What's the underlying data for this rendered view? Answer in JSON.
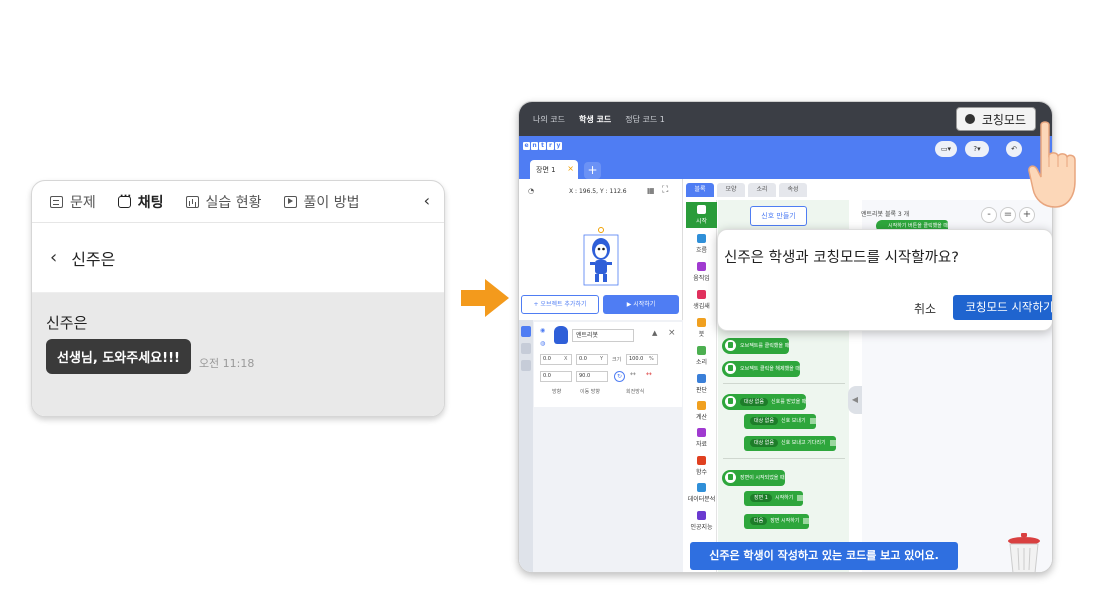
{
  "chat": {
    "tabs": [
      {
        "label": "문제",
        "icon": "document-icon"
      },
      {
        "label": "채팅",
        "icon": "chat-icon"
      },
      {
        "label": "실습 현황",
        "icon": "chart-icon"
      },
      {
        "label": "풀이 방법",
        "icon": "play-icon"
      }
    ],
    "active_tab": "채팅",
    "header_name": "신주은",
    "message": {
      "sender": "신주은",
      "text": "선생님, 도와주세요!!!",
      "time": "오전 11:18"
    }
  },
  "editor": {
    "top_tabs": [
      "나의 코드",
      "학생 코드",
      "정답 코드 1"
    ],
    "active_top_tab": "학생 코드",
    "coaching_mode_label": "코칭모드",
    "logo_letters": [
      "e",
      "n",
      "t",
      "r",
      "y"
    ],
    "scene_tab": "장면 1",
    "coords_text": "X : 196.5, Y : 112.6",
    "add_object_label": "+ 오브젝트 추가하기",
    "start_label": "▶ 시작하기",
    "object": {
      "name": "엔트리봇",
      "x": "0.0",
      "y": "0.0",
      "size": "100.0",
      "direction": "0.0",
      "move_direction": "90.0",
      "labels": {
        "x": "X",
        "y": "Y",
        "size": "크기",
        "size_unit": "%",
        "direction": "방향",
        "move_direction": "이동 방향",
        "rotation": "회전방식"
      }
    },
    "palette_tabs": [
      "블록",
      "모양",
      "소리",
      "속성"
    ],
    "categories": [
      {
        "label": "시작",
        "color": "#2a9c3a",
        "active": true
      },
      {
        "label": "흐름",
        "color": "#2f8fd8"
      },
      {
        "label": "움직임",
        "color": "#a03ad0"
      },
      {
        "label": "생김새",
        "color": "#e0305d"
      },
      {
        "label": "붓",
        "color": "#f0a020"
      },
      {
        "label": "소리",
        "color": "#4caf50"
      },
      {
        "label": "판단",
        "color": "#3a7fd8"
      },
      {
        "label": "계산",
        "color": "#f0a020"
      },
      {
        "label": "자료",
        "color": "#a03ad0"
      },
      {
        "label": "함수",
        "color": "#e04020"
      },
      {
        "label": "데이터분석",
        "color": "#2f8fd8"
      },
      {
        "label": "인공지능",
        "color": "#6a3ad0"
      }
    ],
    "make_signal_label": "신호 만들기",
    "blocks": {
      "obj_click": "오브젝트를 클릭했을 때",
      "obj_release": "오브젝트 클릭을 해제했을 때",
      "signal_recv_target": "대상 없음",
      "signal_recv": "신호를 받았을 때",
      "signal_send_target": "대상 없음",
      "signal_send": "신호 보내기",
      "signal_send_wait_target": "대상 없음",
      "signal_send_wait": "신호 보내고 기다리기",
      "scene_start": "장면이 시작되었을 때",
      "scene_select": "장면 1",
      "scene_begin": "시작하기",
      "next_select": "다음",
      "next_scene": "장면 시작하기"
    },
    "workspace_head": "엔트리봇  블록 3 개",
    "workspace_hint": "시작하기 버튼을 클릭했을 때",
    "zoom": [
      "-",
      "=",
      "+"
    ],
    "dialog": {
      "question": "신주은 학생과 코칭모드를 시작할까요?",
      "cancel": "취소",
      "confirm": "코칭모드 시작하기"
    },
    "notice": "신주은 학생이 작성하고 있는 코드를 보고 있어요."
  },
  "colors": {
    "editor_blue": "#4f7df3",
    "block_green": "#2ea63c",
    "confirm_blue": "#1f64cf",
    "arrow_orange": "#f39a1c",
    "chat_bubble": "#3a3a3a"
  }
}
